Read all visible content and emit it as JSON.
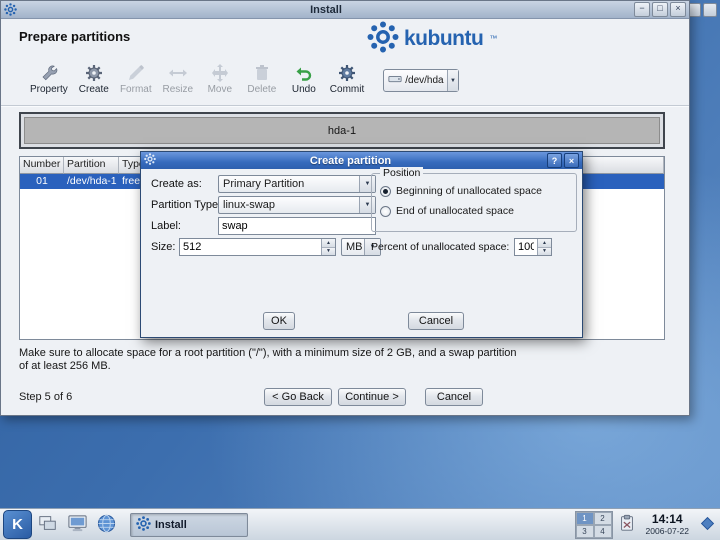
{
  "colors": {
    "selection": "#2a61bd",
    "active_titlebar": "#2f63b0",
    "kubuntu_blue": "#2563b0"
  },
  "glyphs": {
    "minimize": "−",
    "maximize": "□",
    "close": "×",
    "help": "?",
    "dropdown": "▼",
    "spin_up": "▲",
    "spin_down": "▼"
  },
  "main_window": {
    "title": "Install",
    "heading": "Prepare partitions",
    "logo_text": "kubuntu",
    "logo_tm": "™",
    "toolbar": {
      "items": [
        {
          "label": "Property"
        },
        {
          "label": "Create"
        },
        {
          "label": "Format"
        },
        {
          "label": "Resize"
        },
        {
          "label": "Move"
        },
        {
          "label": "Delete"
        },
        {
          "label": "Undo"
        },
        {
          "label": "Commit"
        }
      ],
      "device_combo_value": "/dev/hda"
    },
    "disk_bar_label": "hda-1",
    "table": {
      "columns": [
        "Number",
        "Partition",
        "Type"
      ],
      "rows": [
        {
          "number": "01",
          "partition": "/dev/hda-1",
          "type": "free"
        }
      ]
    },
    "note_line1": "Make sure to allocate space for a root partition (\"/\"), with a minimum size of 2 GB, and a swap partition",
    "note_line2": "of at least 256 MB.",
    "step_label": "Step 5 of 6",
    "go_back_button": "< Go Back",
    "continue_button": "Continue >",
    "cancel_button": "Cancel"
  },
  "dialog": {
    "title": "Create partition",
    "create_as": {
      "label": "Create as:",
      "value": "Primary Partition"
    },
    "partition_type": {
      "label": "Partition Type:",
      "value": "linux-swap"
    },
    "label_field": {
      "label": "Label:",
      "value": "swap"
    },
    "size_field": {
      "label": "Size:",
      "value": "512",
      "unit": "MB"
    },
    "position_group": {
      "title": "Position",
      "options": [
        {
          "label": "Beginning of unallocated space",
          "selected": true
        },
        {
          "label": "End of unallocated space",
          "selected": false
        }
      ]
    },
    "percent_field": {
      "label": "Percent of unallocated space:",
      "value": "100"
    },
    "ok_button": "OK",
    "cancel_button": "Cancel"
  },
  "taskbar": {
    "k_menu": "K",
    "task_button_label": "Install",
    "pager_cells": [
      "1",
      "2",
      "3",
      "4"
    ],
    "clock_time": "14:14",
    "clock_date": "2006-07-22"
  }
}
